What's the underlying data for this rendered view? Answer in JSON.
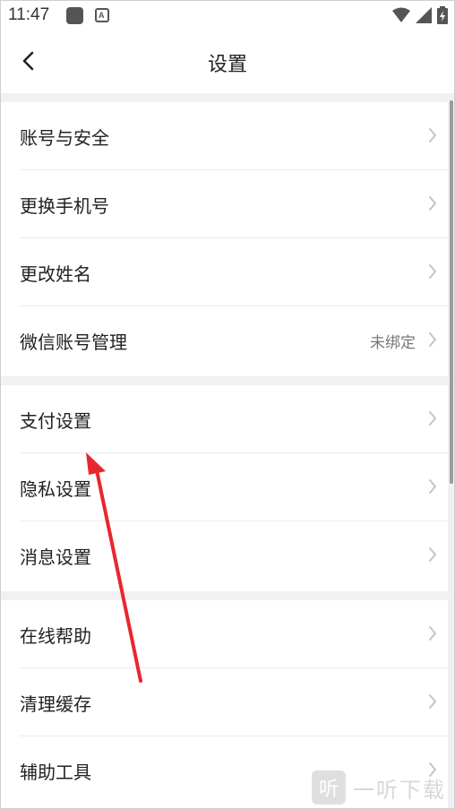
{
  "status_bar": {
    "time": "11:47"
  },
  "header": {
    "title": "设置"
  },
  "sections": [
    {
      "items": [
        {
          "label": "账号与安全",
          "value": ""
        },
        {
          "label": "更换手机号",
          "value": ""
        },
        {
          "label": "更改姓名",
          "value": ""
        },
        {
          "label": "微信账号管理",
          "value": "未绑定"
        }
      ]
    },
    {
      "items": [
        {
          "label": "支付设置",
          "value": ""
        },
        {
          "label": "隐私设置",
          "value": ""
        },
        {
          "label": "消息设置",
          "value": ""
        }
      ]
    },
    {
      "items": [
        {
          "label": "在线帮助",
          "value": ""
        },
        {
          "label": "清理缓存",
          "value": ""
        },
        {
          "label": "辅助工具",
          "value": ""
        }
      ]
    }
  ],
  "watermark": {
    "logo": "听",
    "text": "一听下载"
  },
  "colors": {
    "background": "#f1f1f3",
    "annotation_arrow": "#e8262f",
    "chevron": "#c4c4c4"
  }
}
